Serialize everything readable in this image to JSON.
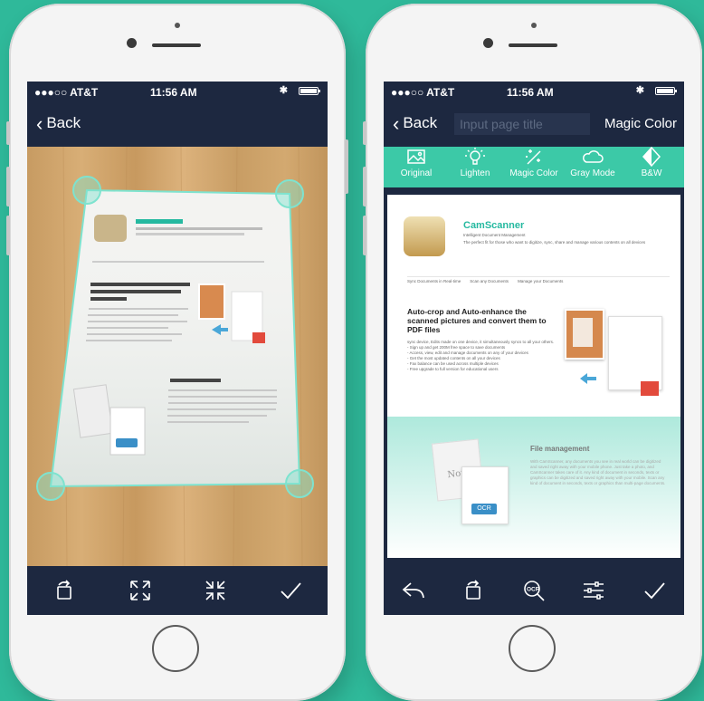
{
  "left_phone": {
    "status": {
      "carrier": "●●●○○ AT&T",
      "time": "11:56 AM",
      "bluetooth": "✱"
    },
    "nav": {
      "back_label": "Back"
    },
    "document": {
      "app_name": "CamScanner",
      "headline": "Auto-crop and Auto-enhance the scanned pictures and convert them to PDF files",
      "section_title": "File management"
    },
    "toolbar": [
      "rotate-icon",
      "expand-icon",
      "collapse-icon",
      "checkmark-icon"
    ]
  },
  "right_phone": {
    "status": {
      "carrier": "●●●○○ AT&T",
      "time": "11:56 AM",
      "bluetooth": "✱"
    },
    "nav": {
      "back_label": "Back",
      "title_placeholder": "Input page title",
      "mode_label": "Magic Color"
    },
    "filters": [
      {
        "label": "Original",
        "icon": "image-icon"
      },
      {
        "label": "Lighten",
        "icon": "bulb-icon"
      },
      {
        "label": "Magic Color",
        "icon": "sparkle-icon"
      },
      {
        "label": "Gray Mode",
        "icon": "cloud-icon"
      },
      {
        "label": "B&W",
        "icon": "contrast-icon"
      }
    ],
    "document": {
      "app_name": "CamScanner",
      "tagline": "Intelligent Document Management",
      "intro": "The perfect fit for those who want to digitize, sync, share and manage various contents on all devices",
      "links": [
        "Sync Documents in Real-time",
        "Scan any Documents",
        "Manage your Documents"
      ],
      "headline": "Auto-crop and Auto-enhance the scanned pictures and convert them to PDF files",
      "bullets": [
        "sync device, Edits made on one device, it simultaneously syncs to all your others.",
        "- Sign up and get 200M free space to save documents",
        "- Access, view, edit and manage documents on any of your devices",
        "- Get the most updated contents on all your devices",
        "- Fax balance can be used across multiple devices",
        "- Free upgrade to full version for educational users"
      ],
      "section_title": "File management",
      "section_text": "With CamScanner, any documents you see in real world can be digitized and saved right away with your mobile phone. Just take a photo, and CamScanner takes care of it. Any kind of document in seconds, texts or graphics can be digitized and saved right away with your mobile. Scan any kind of document in seconds, texts or graphics than multi-page documents.",
      "note_label": "Note",
      "ocr_label": "OCR"
    },
    "toolbar": [
      "undo-icon",
      "rotate-icon",
      "ocr-icon",
      "adjust-icon",
      "checkmark-icon"
    ]
  },
  "colors": {
    "background": "#2fb99a",
    "screen_bar": "#1d2840",
    "accent": "#3cc9a7",
    "handle": "#7ee3cf"
  }
}
